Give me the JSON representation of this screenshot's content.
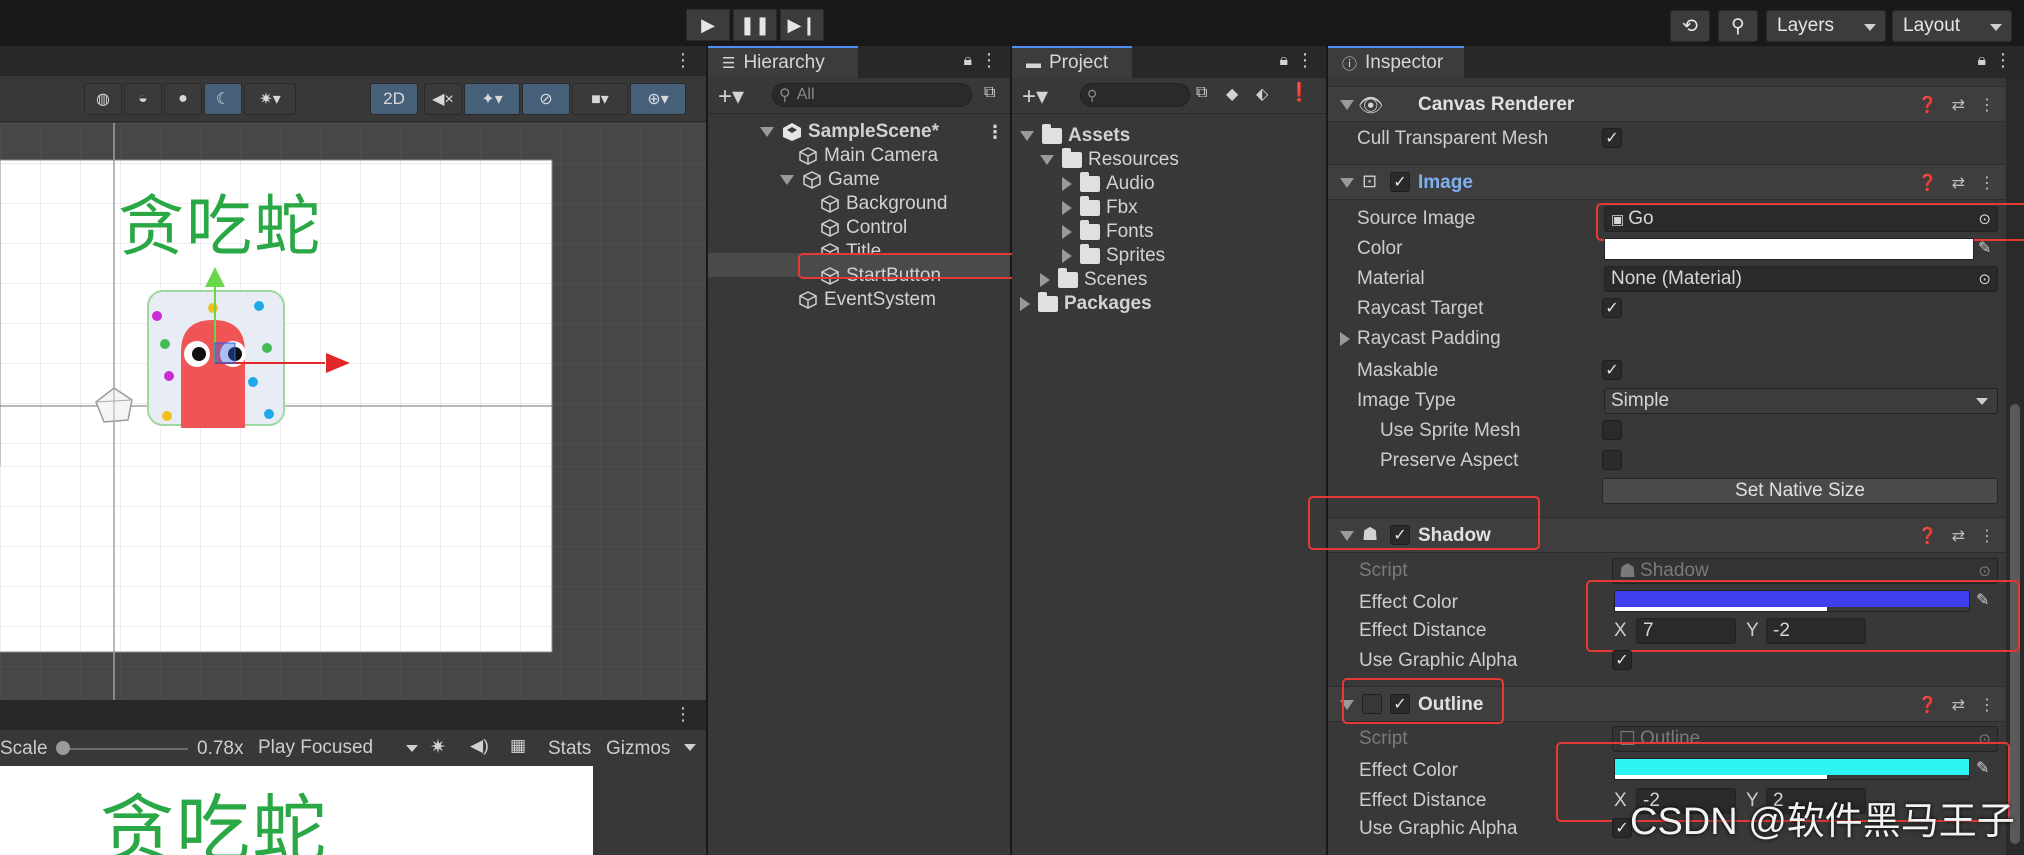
{
  "toolbar": {
    "play_icon": "play-icon",
    "pause_icon": "pause-icon",
    "step_icon": "step-icon",
    "history_icon": "history-icon",
    "search_icon": "search-icon",
    "layers_label": "Layers",
    "layout_label": "Layout"
  },
  "scene_view": {
    "toolbar": {
      "mode_2d_label": "2D"
    },
    "title_text": "贪吃蛇"
  },
  "game_view": {
    "scale_label": "Scale",
    "scale_value": "0.78x",
    "play_mode": "Play Focused",
    "stats_label": "Stats",
    "gizmos_label": "Gizmos",
    "title_text": "贪吃蛇"
  },
  "hierarchy": {
    "tab_label": "Hierarchy",
    "search_placeholder": "All",
    "scene_name": "SampleScene*",
    "items": {
      "main_camera": "Main Camera",
      "game": "Game",
      "background": "Background",
      "control": "Control",
      "title": "Title",
      "start_button": "StartButton",
      "event_system": "EventSystem"
    }
  },
  "project": {
    "tab_label": "Project",
    "assets": "Assets",
    "resources": "Resources",
    "audio": "Audio",
    "fbx": "Fbx",
    "fonts": "Fonts",
    "sprites": "Sprites",
    "scenes": "Scenes",
    "packages": "Packages"
  },
  "inspector": {
    "tab_label": "Inspector",
    "canvas_renderer": {
      "title": "Canvas Renderer",
      "cull_label": "Cull Transparent Mesh"
    },
    "image": {
      "title": "Image",
      "source_image_label": "Source Image",
      "source_image_value": "Go",
      "color_label": "Color",
      "material_label": "Material",
      "material_value": "None (Material)",
      "raycast_target_label": "Raycast Target",
      "raycast_padding_label": "Raycast Padding",
      "maskable_label": "Maskable",
      "image_type_label": "Image Type",
      "image_type_value": "Simple",
      "use_sprite_mesh_label": "Use Sprite Mesh",
      "preserve_aspect_label": "Preserve Aspect",
      "set_native_size_label": "Set Native Size"
    },
    "shadow": {
      "title": "Shadow",
      "script_label": "Script",
      "script_value": "Shadow",
      "effect_color_label": "Effect Color",
      "effect_color": "#3f3fef",
      "effect_distance_label": "Effect Distance",
      "x_label": "X",
      "x_value": "7",
      "y_label": "Y",
      "y_value": "-2",
      "use_graphic_alpha_label": "Use Graphic Alpha"
    },
    "outline": {
      "title": "Outline",
      "script_label": "Script",
      "script_value": "Outline",
      "effect_color_label": "Effect Color",
      "effect_color": "#2ff4f4",
      "effect_distance_label": "Effect Distance",
      "x_label": "X",
      "x_value": "-2",
      "y_label": "Y",
      "y_value": "2",
      "use_graphic_alpha_label": "Use Graphic Alpha"
    }
  },
  "watermark": "CSDN @软件黑马王子"
}
